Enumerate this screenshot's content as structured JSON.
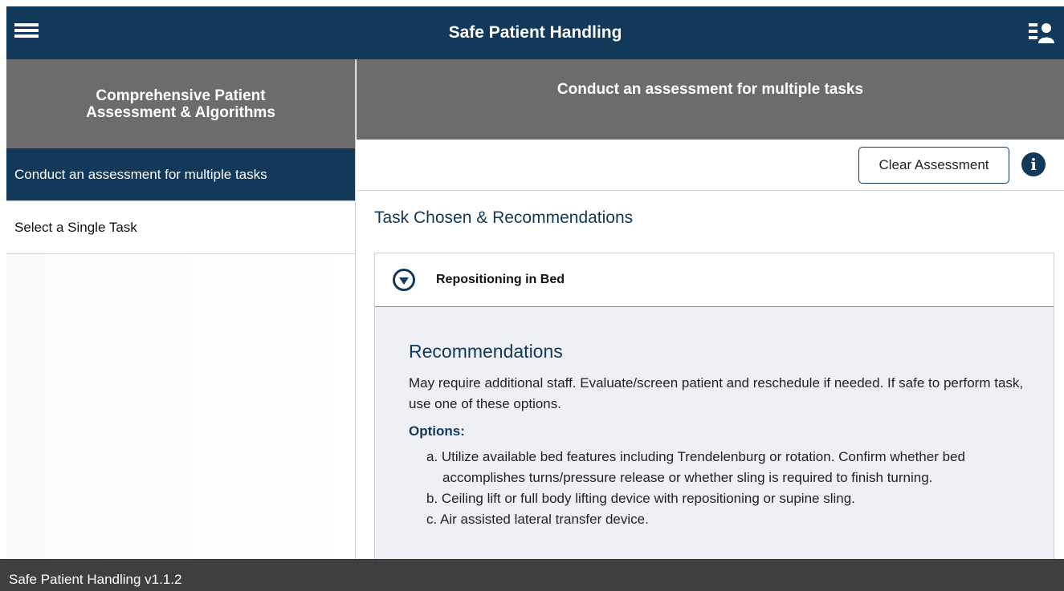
{
  "app": {
    "title": "Safe Patient Handling"
  },
  "icons": {
    "menu": "hamburger-menu-icon",
    "user": "user-list-icon",
    "info": "info-icon",
    "expand": "chevron-down-circle-icon"
  },
  "colors": {
    "primary": "#12385a",
    "header_gray": "#6c6c6c",
    "footer": "#3f3f3f"
  },
  "sidebar": {
    "header": "Comprehensive Patient Assessment & Algorithms",
    "items": [
      {
        "label": "Conduct an assessment for multiple tasks",
        "active": true
      },
      {
        "label": "Select a Single Task",
        "active": false
      }
    ]
  },
  "main": {
    "header": "Conduct an assessment for multiple tasks",
    "clear_button": "Clear Assessment",
    "section_title": "Task Chosen & Recommendations",
    "card": {
      "task": "Repositioning in Bed",
      "rec_title": "Recommendations",
      "rec_text": "May require additional staff. Evaluate/screen patient and reschedule if needed. If safe to perform task, use one of these options.",
      "options_label": "Options:",
      "options": [
        "a. Utilize available bed features including Trendelenburg or rotation. Confirm whether bed accomplishes turns/pressure release or whether sling is required to finish turning.",
        "b. Ceiling lift or full body lifting device with repositioning or supine sling.",
        "c. Air assisted lateral transfer device."
      ]
    }
  },
  "footer": {
    "version": "Safe Patient Handling v1.1.2"
  }
}
